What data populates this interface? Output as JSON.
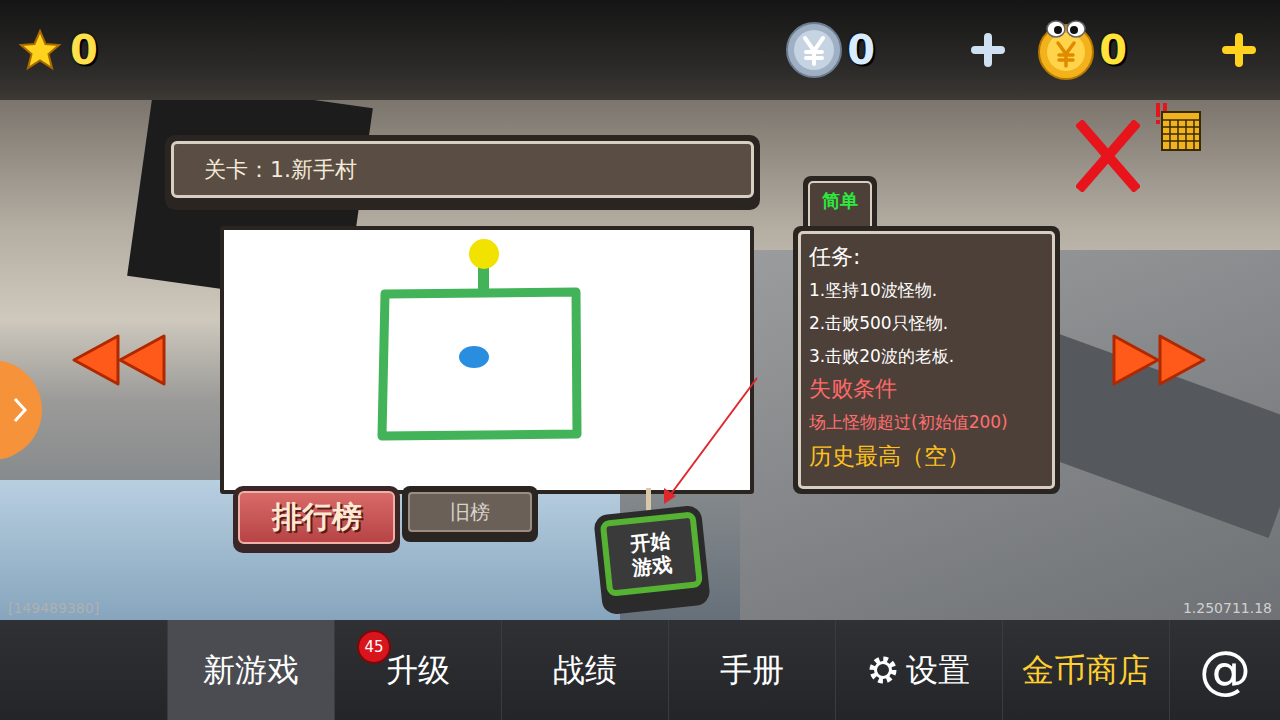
{
  "currencies": {
    "stars": "0",
    "silver": "0",
    "gold": "0"
  },
  "level": {
    "title": "关卡：1.新手村",
    "difficulty": "简单",
    "tasks_heading": "任务:",
    "tasks": [
      "1.坚持10波怪物.",
      "2.击败500只怪物.",
      "3.击败20波的老板."
    ],
    "fail_heading": "失败条件",
    "fail_condition": "场上怪物超过(初始值200)",
    "best": "历史最高（空）"
  },
  "buttons": {
    "leaderboard": "排行榜",
    "old_leaderboard": "旧榜",
    "start": "开始游戏"
  },
  "player_id": "[149489380]",
  "version": "1.250711.18",
  "nav": [
    {
      "label": "新游戏",
      "selected": true,
      "kind": "text",
      "color": "#ffffff"
    },
    {
      "label": "升级",
      "selected": false,
      "kind": "badge",
      "badge": "45",
      "color": "#ffffff"
    },
    {
      "label": "战绩",
      "selected": false,
      "kind": "text",
      "color": "#ffffff"
    },
    {
      "label": "手册",
      "selected": false,
      "kind": "text",
      "color": "#ffffff"
    },
    {
      "label": "设置",
      "selected": false,
      "kind": "settings",
      "color": "#ffffff"
    },
    {
      "label": "金币商店",
      "selected": false,
      "kind": "text",
      "color": "#ffd030"
    },
    {
      "label": "@",
      "selected": false,
      "kind": "symbol",
      "color": "#ffffff"
    }
  ]
}
